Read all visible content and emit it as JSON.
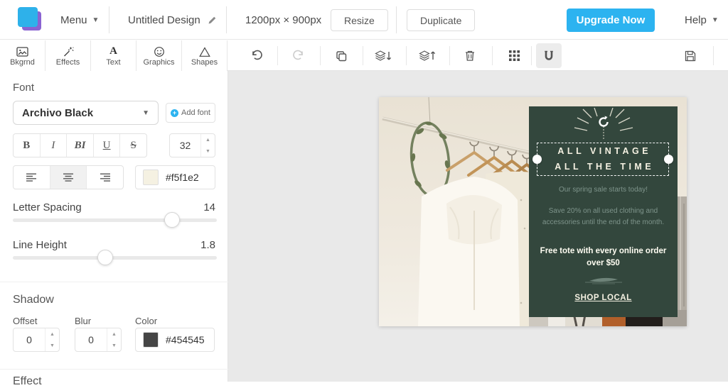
{
  "topbar": {
    "menu_label": "Menu",
    "title": "Untitled Design",
    "dimensions": "1200px × 900px",
    "resize_label": "Resize",
    "duplicate_label": "Duplicate",
    "upgrade_label": "Upgrade Now",
    "help_label": "Help"
  },
  "toolbar": {
    "tabs": [
      {
        "label": "Bkgrnd",
        "icon": "image-icon"
      },
      {
        "label": "Effects",
        "icon": "magic-wand-icon"
      },
      {
        "label": "Text",
        "icon": "letter-a-icon"
      },
      {
        "label": "Graphics",
        "icon": "smiley-icon"
      },
      {
        "label": "Shapes",
        "icon": "triangle-icon"
      }
    ],
    "action_icons": [
      "undo-icon",
      "redo-icon",
      "duplicate-icon",
      "send-backward-icon",
      "bring-forward-icon",
      "trash-icon",
      "grid-icon",
      "magnet-icon",
      "save-icon"
    ],
    "text_a": "A"
  },
  "font_panel": {
    "section_title": "Font",
    "font_name": "Archivo Black",
    "add_font_label": "Add font",
    "style_buttons": [
      "B",
      "I",
      "BI",
      "U",
      "S"
    ],
    "font_size": "32",
    "text_color_hex": "#f5f1e2",
    "letter_spacing": {
      "label": "Letter Spacing",
      "value": "14"
    },
    "line_height": {
      "label": "Line Height",
      "value": "1.8"
    },
    "shadow": {
      "section_title": "Shadow",
      "offset_label": "Offset",
      "offset_value": "0",
      "blur_label": "Blur",
      "blur_value": "0",
      "color_label": "Color",
      "color_hex": "#454545"
    },
    "next_section_partial": "Effect"
  },
  "canvas": {
    "design": {
      "headline_line1": "ALL VINTAGE",
      "headline_line2": "ALL THE TIME",
      "subtext1": "Our spring sale starts today!",
      "subtext2": "Save 20% on all used clothing and accessories until the end of the month.",
      "highlight": "Free tote with every online order over $50",
      "cta": "SHOP LOCAL"
    }
  },
  "colors": {
    "accent_blue": "#2cb3f0",
    "logo_blue": "#2eb1ea",
    "logo_purple": "#8a63d2",
    "panel_green": "#33473d",
    "cream_text": "#f5f1e2",
    "shadow_swatch": "#454545",
    "canvas_bg": "#e9e9e9"
  }
}
